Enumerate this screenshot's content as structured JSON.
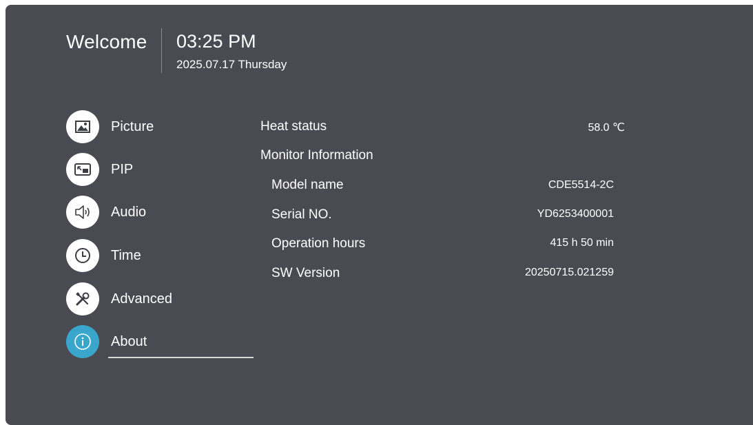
{
  "header": {
    "welcome": "Welcome",
    "time": "03:25 PM",
    "date": "2025.07.17 Thursday"
  },
  "menu": {
    "items": [
      {
        "label": "Picture",
        "icon": "picture-icon"
      },
      {
        "label": "PIP",
        "icon": "pip-icon"
      },
      {
        "label": "Audio",
        "icon": "speaker-icon"
      },
      {
        "label": "Time",
        "icon": "clock-icon"
      },
      {
        "label": "Advanced",
        "icon": "tools-icon"
      },
      {
        "label": "About",
        "icon": "info-icon",
        "selected": true
      }
    ]
  },
  "about": {
    "heat_status_label": "Heat status",
    "heat_status_value": "58.0 ℃",
    "monitor_info_label": "Monitor Information",
    "model_name_label": "Model name",
    "model_name_value": "CDE5514-2C",
    "serial_label": "Serial NO.",
    "serial_value": "YD6253400001",
    "operation_hours_label": "Operation hours",
    "operation_hours_value": "415 h 50 min",
    "sw_version_label": "SW Version",
    "sw_version_value": "20250715.021259"
  },
  "colors": {
    "panel_background": "#4a4a52",
    "selected_accent": "#3aa6cc",
    "text": "#ffffff"
  }
}
